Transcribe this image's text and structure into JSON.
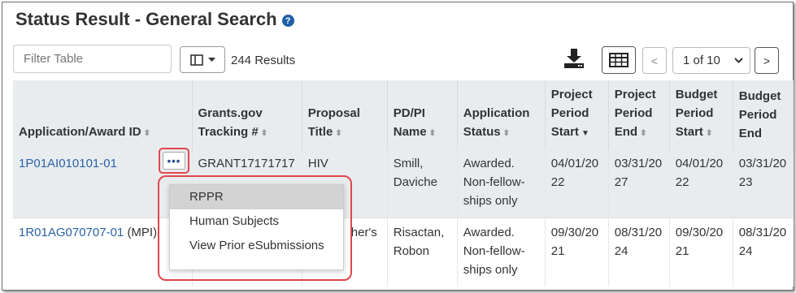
{
  "page": {
    "title": "Status Result - General Search",
    "help_icon": "question-circle-icon"
  },
  "toolbar": {
    "filter_placeholder": "Filter Table",
    "column_icon": "columns-icon",
    "results_text": "244 Results",
    "download_icon": "download-icon",
    "grid_icon": "table-grid-icon",
    "prev_label": "<",
    "page_selected": "1 of 10",
    "next_label": ">"
  },
  "table": {
    "headers": [
      "Application/Award ID",
      "Grants.gov Tracking #",
      "Proposal Title",
      "PD/PI Name",
      "Application Status",
      "Project Period Start",
      "Project Period End",
      "Budget Period Start",
      "Budget Period End"
    ],
    "rows": [
      {
        "app_id": "1P01AI010101-01",
        "app_suffix": "",
        "tracking": "GRANT17171717",
        "title": "HIV",
        "pi": "Smill, Daviche",
        "status": "Awarded. Non-fellow-ships only",
        "proj_start": "04/01/20 22",
        "proj_end": "03/31/20 27",
        "budget_start": "04/01/20 22",
        "budget_end": "03/31/20 23"
      },
      {
        "app_id": "1R01AG070707-01",
        "app_suffix": "(MPI)",
        "tracking": "",
        "title": "her's",
        "pi": "Risactan, Robon",
        "status": "Awarded. Non-fellow-ships only",
        "proj_start": "09/30/20 21",
        "proj_end": "08/31/20 24",
        "budget_start": "09/30/20 21",
        "budget_end": "08/31/20 24"
      }
    ]
  },
  "menu": {
    "trigger_label": "•••",
    "items": [
      "RPPR",
      "Human Subjects",
      "View Prior eSubmissions"
    ]
  },
  "colors": {
    "link": "#2a62a6",
    "highlight": "#e0474c",
    "header_bg": "#e9ecef"
  }
}
